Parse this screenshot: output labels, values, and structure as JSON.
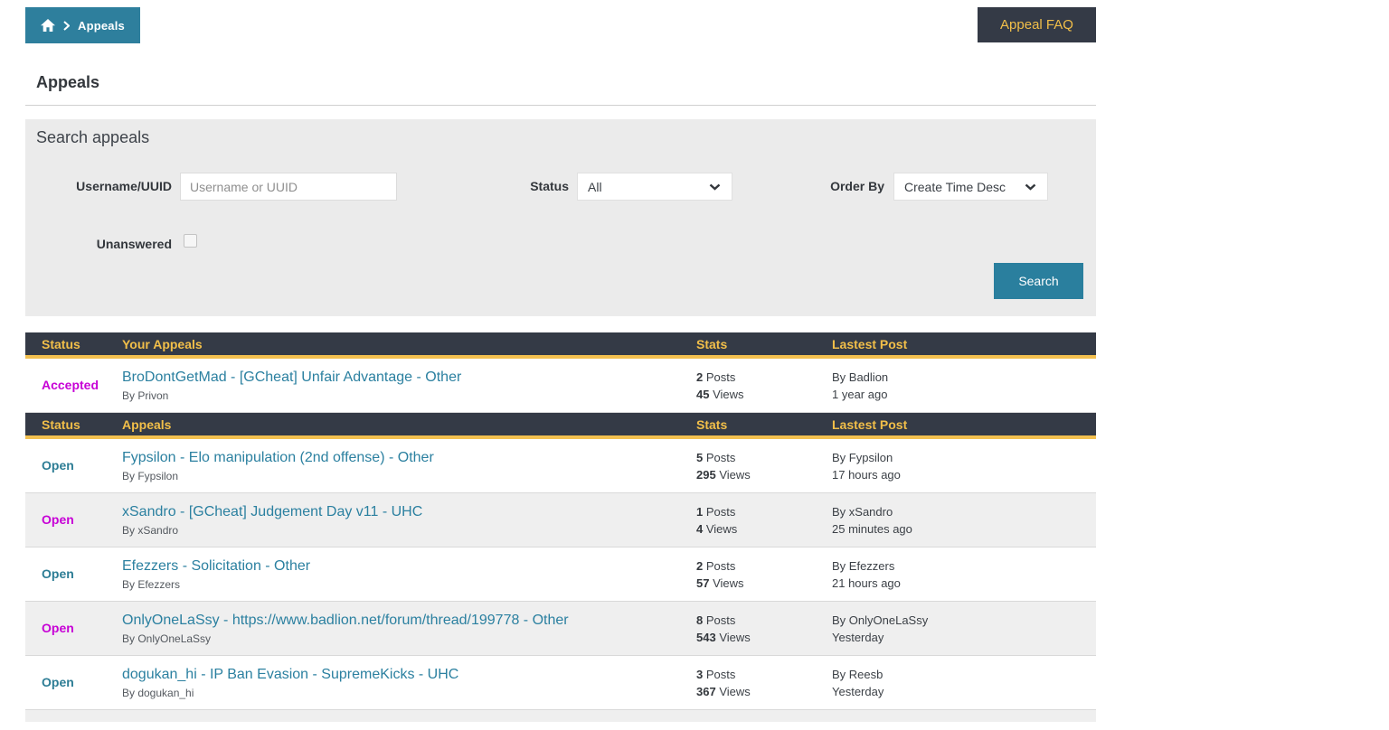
{
  "colors": {
    "accent_teal": "#2e7f9d",
    "dark_header": "#343a46",
    "gold": "#f2bf49",
    "open_teal": "#2d7d95",
    "magenta": "#c700d6",
    "panel_bg": "#ebebeb"
  },
  "breadcrumb": {
    "current": "Appeals"
  },
  "header": {
    "faq_button": "Appeal FAQ",
    "page_title": "Appeals"
  },
  "search": {
    "title": "Search appeals",
    "username_label": "Username/UUID",
    "username_value": "",
    "username_placeholder": "Username or UUID",
    "status_label": "Status",
    "status_value": "All",
    "order_label": "Order By",
    "order_value": "Create Time Desc",
    "unanswered_label": "Unanswered",
    "unanswered_checked": false,
    "search_button": "Search"
  },
  "stat_labels": {
    "posts": "Posts",
    "views": "Views"
  },
  "tables": [
    {
      "headers": [
        "Status",
        "Your Appeals",
        "Stats",
        "Lastest Post"
      ],
      "rows": [
        {
          "status": "Accepted",
          "status_color": "#c700d6",
          "title": "BroDontGetMad - [GCheat] Unfair Advantage - Other",
          "author": "By Privon",
          "posts": "2",
          "views": "45",
          "last_by": "By Badlion",
          "last_time": "1 year ago",
          "shaded": false
        }
      ]
    },
    {
      "headers": [
        "Status",
        "Appeals",
        "Stats",
        "Lastest Post"
      ],
      "rows": [
        {
          "status": "Open",
          "status_color": "#2d7d95",
          "title": "Fypsilon - Elo manipulation (2nd offense) - Other",
          "author": "By Fypsilon",
          "posts": "5",
          "views": "295",
          "last_by": "By Fypsilon",
          "last_time": "17 hours ago",
          "shaded": false
        },
        {
          "status": "Open",
          "status_color": "#c700d6",
          "title": "xSandro - [GCheat] Judgement Day v11 - UHC",
          "author": "By xSandro",
          "posts": "1",
          "views": "4",
          "last_by": "By xSandro",
          "last_time": "25 minutes ago",
          "shaded": true
        },
        {
          "status": "Open",
          "status_color": "#2d7d95",
          "title": "Efezzers - Solicitation - Other",
          "author": "By Efezzers",
          "posts": "2",
          "views": "57",
          "last_by": "By Efezzers",
          "last_time": "21 hours ago",
          "shaded": false
        },
        {
          "status": "Open",
          "status_color": "#c700d6",
          "title": "OnlyOneLaSsy - https://www.badlion.net/forum/thread/199778 - Other",
          "author": "By OnlyOneLaSsy",
          "posts": "8",
          "views": "543",
          "last_by": "By OnlyOneLaSsy",
          "last_time": "Yesterday",
          "shaded": true
        },
        {
          "status": "Open",
          "status_color": "#2d7d95",
          "title": "dogukan_hi - IP Ban Evasion - SupremeKicks - UHC",
          "author": "By dogukan_hi",
          "posts": "3",
          "views": "367",
          "last_by": "By Reesb",
          "last_time": "Yesterday",
          "shaded": false
        }
      ]
    }
  ]
}
